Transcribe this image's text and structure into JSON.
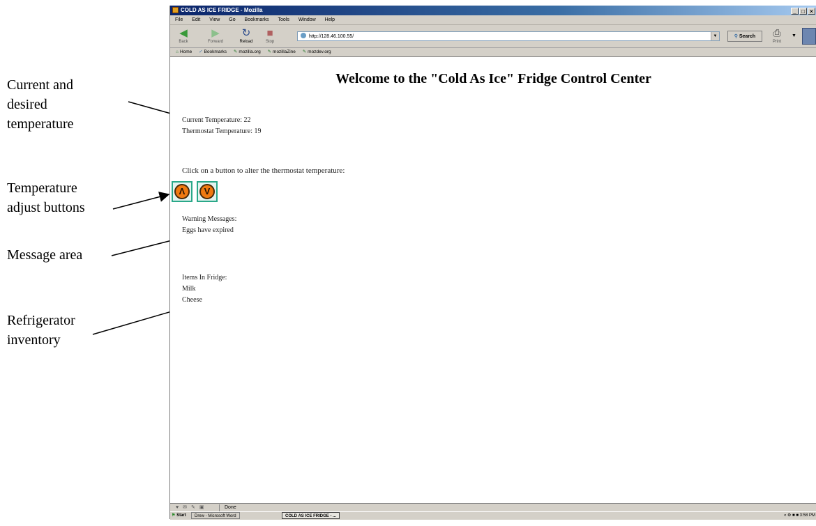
{
  "annotations": {
    "temperature": "Current and\ndesired\ntemperature",
    "buttons": "Temperature\nadjust buttons",
    "messages": "Message area",
    "inventory": "Refrigerator\ninventory"
  },
  "browser": {
    "title": "COLD AS ICE FRIDGE - Mozilla",
    "menu": [
      "File",
      "Edit",
      "View",
      "Go",
      "Bookmarks",
      "Tools",
      "Window",
      "Help"
    ],
    "nav": {
      "back": "Back",
      "forward": "Forward",
      "reload": "Reload",
      "stop": "Stop",
      "print": "Print",
      "search": "Search"
    },
    "url": "http://128.46.100.55/",
    "bookmarks": [
      "Home",
      "Bookmarks",
      "mozilla.org",
      "mozillaZine",
      "mozdev.org"
    ],
    "status": "Done"
  },
  "page": {
    "heading": "Welcome to the \"Cold As Ice\" Fridge Control Center",
    "current_temp": "Current Temperature: 22",
    "thermostat_temp": "Thermostat Temperature: 19",
    "instruction": "Click on a button to alter the thermostat temperature:",
    "warning_label": "Warning Messages:",
    "warning_message": "Eggs have expired",
    "items_label": "Items In Fridge:",
    "items": [
      "Milk",
      "Cheese"
    ]
  },
  "taskbar": {
    "start": "Start",
    "task_word": "Drew - Microsoft Word",
    "task_browser": "COLD AS ICE FRIDGE - ...",
    "clock": "3:58 PM"
  },
  "icons": {
    "up": "up-arrow-icon",
    "down": "down-arrow-icon"
  },
  "colors": {
    "button_fill": "#f07a10",
    "button_border": "#2aa889",
    "titlebar": "#0a246a"
  }
}
